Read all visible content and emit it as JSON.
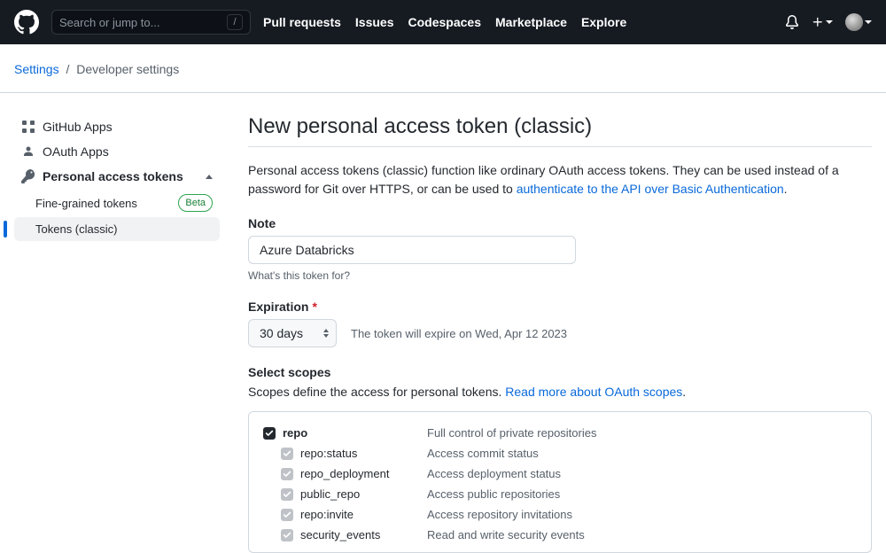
{
  "header": {
    "search_placeholder": "Search or jump to...",
    "slash": "/",
    "nav": [
      "Pull requests",
      "Issues",
      "Codespaces",
      "Marketplace",
      "Explore"
    ]
  },
  "breadcrumb": {
    "settings": "Settings",
    "sep": "/",
    "current": "Developer settings"
  },
  "sidebar": {
    "github_apps": "GitHub Apps",
    "oauth_apps": "OAuth Apps",
    "pat": "Personal access tokens",
    "fine_grained": "Fine-grained tokens",
    "beta": "Beta",
    "tokens_classic": "Tokens (classic)"
  },
  "page": {
    "title": "New personal access token (classic)",
    "intro_1": "Personal access tokens (classic) function like ordinary OAuth access tokens. They can be used instead of a password for Git over HTTPS, or can be used to ",
    "intro_link": "authenticate to the API over Basic Authentication",
    "intro_2": ".",
    "note_label": "Note",
    "note_value": "Azure Databricks",
    "note_hint": "What's this token for?",
    "expiration_label": "Expiration",
    "expiration_value": "30 days",
    "expiration_note": "The token will expire on Wed, Apr 12 2023",
    "select_scopes": "Select scopes",
    "scopes_sub_1": "Scopes define the access for personal tokens. ",
    "scopes_sub_link": "Read more about OAuth scopes",
    "scopes_sub_2": "."
  },
  "scopes": [
    {
      "name": "repo",
      "desc": "Full control of private repositories",
      "checked": true,
      "child": false
    },
    {
      "name": "repo:status",
      "desc": "Access commit status",
      "checked": true,
      "child": true
    },
    {
      "name": "repo_deployment",
      "desc": "Access deployment status",
      "checked": true,
      "child": true
    },
    {
      "name": "public_repo",
      "desc": "Access public repositories",
      "checked": true,
      "child": true
    },
    {
      "name": "repo:invite",
      "desc": "Access repository invitations",
      "checked": true,
      "child": true
    },
    {
      "name": "security_events",
      "desc": "Read and write security events",
      "checked": true,
      "child": true
    }
  ]
}
